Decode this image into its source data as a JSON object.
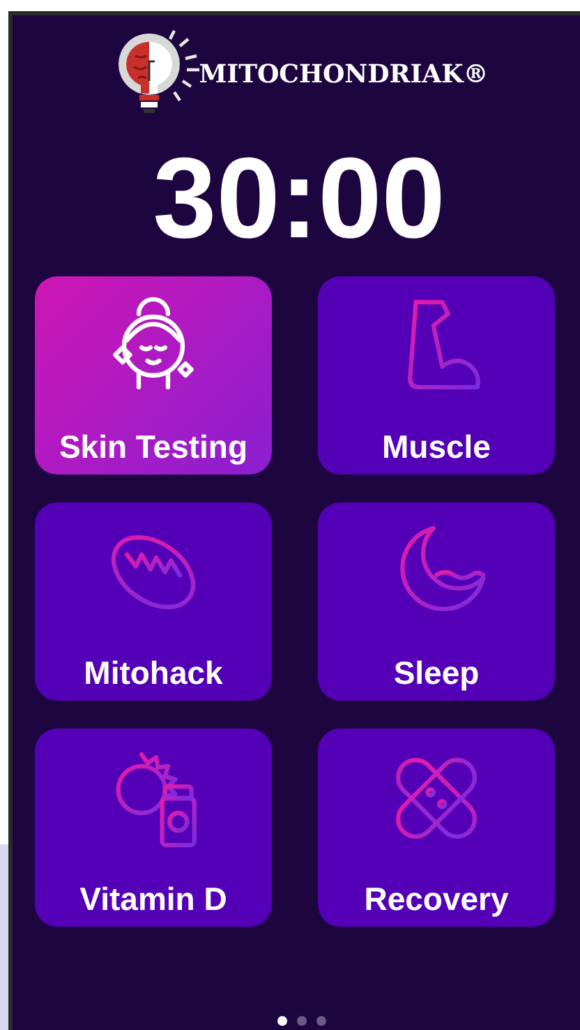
{
  "brand": {
    "name": "MITOCHONDRIAK®"
  },
  "timer": "30:00",
  "tiles": [
    {
      "label": "Skin Testing",
      "kind": "face",
      "selected": true
    },
    {
      "label": "Muscle",
      "kind": "muscle",
      "selected": false
    },
    {
      "label": "Mitohack",
      "kind": "mitochondrion",
      "selected": false
    },
    {
      "label": "Sleep",
      "kind": "moon",
      "selected": false
    },
    {
      "label": "Vitamin D",
      "kind": "vitamin",
      "selected": false
    },
    {
      "label": "Recovery",
      "kind": "bandage",
      "selected": false
    }
  ],
  "pages": [
    {
      "selected": true
    },
    {
      "selected": false
    },
    {
      "selected": false
    }
  ]
}
